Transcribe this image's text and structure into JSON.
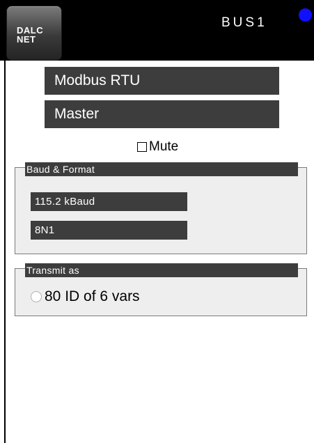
{
  "header": {
    "logo_line1": "DALC",
    "logo_line2": "NET",
    "bus_title": "BUS1",
    "status_color": "#1010ff"
  },
  "protocol": {
    "selected": "Modbus RTU"
  },
  "role": {
    "selected": "Master"
  },
  "mute": {
    "label": "Mute",
    "checked": false
  },
  "baud_format": {
    "legend": "Baud & Format",
    "baud_selected": "115.2 kBaud",
    "format_selected": "8N1"
  },
  "transmit": {
    "legend": "Transmit as",
    "option_label": "80 ID of 6 vars",
    "option_selected": false
  }
}
